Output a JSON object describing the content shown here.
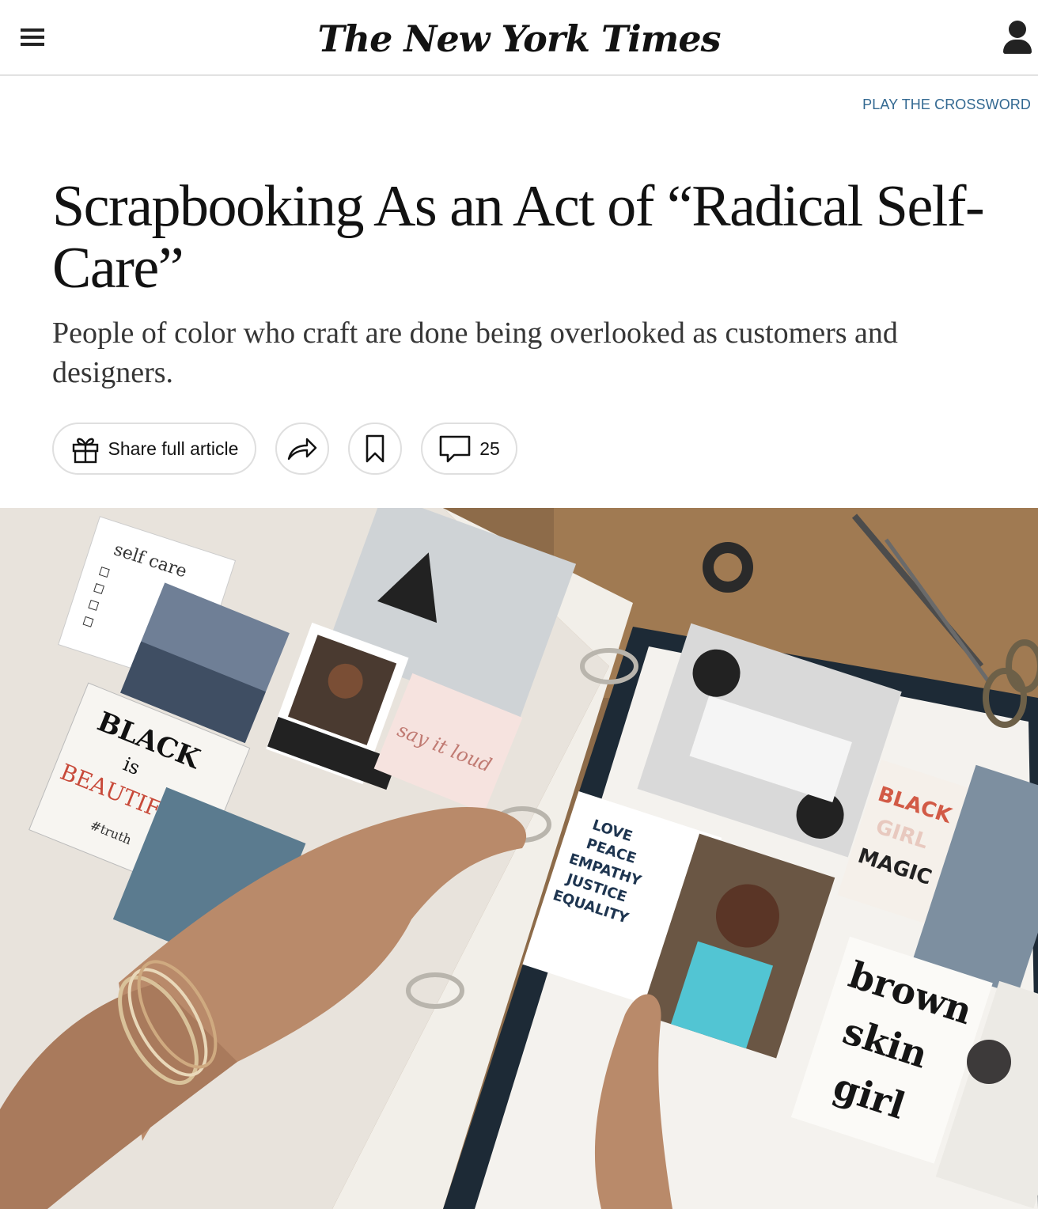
{
  "header": {
    "logo_text": "The New York Times",
    "menu_icon": "hamburger-menu-icon",
    "account_icon": "user-account-icon"
  },
  "promo": {
    "crossword_label": "PLAY THE CROSSWORD",
    "color": "#326891"
  },
  "article": {
    "headline": "Scrapbooking As an Act of “Radical Self-Care”",
    "summary": "People of color who craft are done being overlooked as customers and designers."
  },
  "toolbar": {
    "share_full_label": "Share full article",
    "share_full_icon": "gift-icon",
    "share_icon": "share-arrow-icon",
    "save_icon": "bookmark-icon",
    "comments_icon": "comment-bubble-icon",
    "comments_count": "25"
  },
  "photo": {
    "description_labels": {
      "self_care": "self care",
      "black_is": "BLACK",
      "is": "is",
      "beautiful": "BEAUTIFUL",
      "truth": "#truth",
      "say_it_loud": "say it loud",
      "black_girl_magic_1": "BLACK",
      "black_girl_magic_2": "GIRL",
      "black_girl_magic_3": "MAGIC",
      "brown": "brown",
      "skin": "skin",
      "girl": "girl",
      "love": "LOVE",
      "peace": "PEACE",
      "empathy": "EMPATHY",
      "justice": "JUSTICE",
      "equality": "EQUALITY"
    }
  }
}
